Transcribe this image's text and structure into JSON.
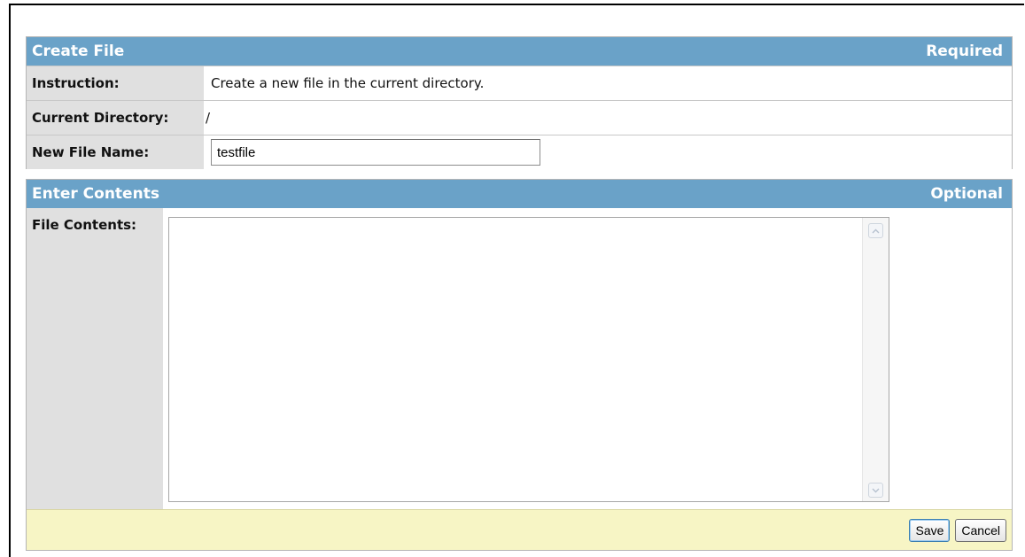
{
  "create_panel": {
    "title": "Create File",
    "badge": "Required",
    "instruction_label": "Instruction:",
    "instruction_text": "Create a new file in the current directory.",
    "directory_label": "Current Directory:",
    "directory_value": "/",
    "filename_label": "New File Name:",
    "filename_value": "testfile"
  },
  "contents_panel": {
    "title": "Enter Contents",
    "badge": "Optional",
    "contents_label": "File Contents:",
    "contents_value": ""
  },
  "footer": {
    "save_label": "Save",
    "cancel_label": "Cancel"
  },
  "icons": {
    "scroll_up": "chevron-up-icon",
    "scroll_down": "chevron-down-icon"
  },
  "colors": {
    "header_bg": "#6aa2c8",
    "label_bg": "#e0e0e0",
    "footer_bg": "#f7f5c5"
  }
}
